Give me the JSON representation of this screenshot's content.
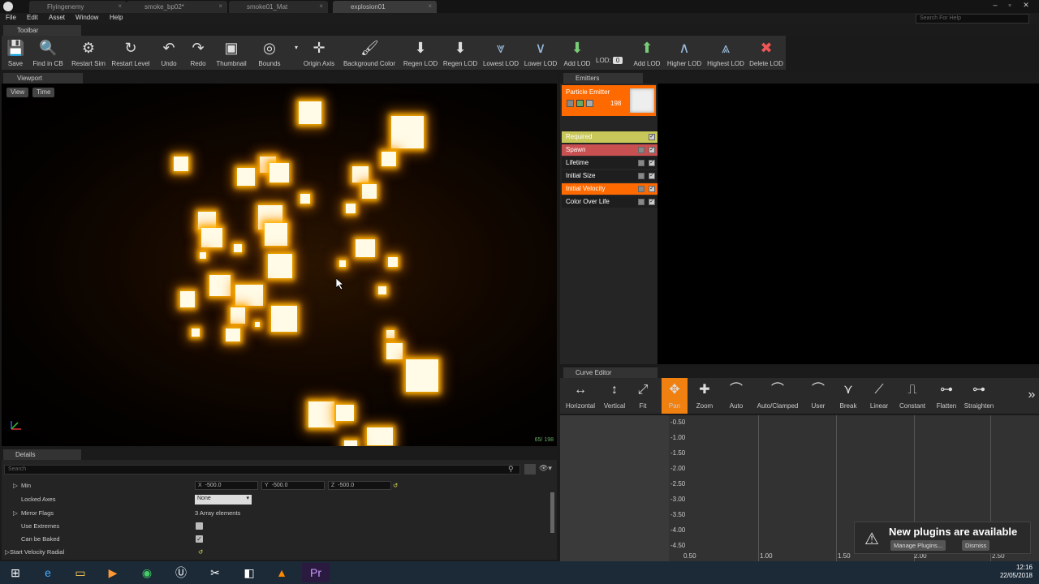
{
  "tabs": [
    {
      "label": "Flyingenemy"
    },
    {
      "label": "smoke_bp02*"
    },
    {
      "label": "smoke01_Mat"
    },
    {
      "label": "explosion01"
    }
  ],
  "menu": [
    "File",
    "Edit",
    "Asset",
    "Window",
    "Help"
  ],
  "search_help": {
    "placeholder": "Search For Help"
  },
  "toolbar": {
    "title": "Toolbar",
    "items": [
      {
        "label": "Save",
        "icon": "save-icon"
      },
      {
        "label": "Find in CB",
        "icon": "search-icon"
      },
      {
        "label": "Restart Sim",
        "icon": "gear-icon"
      },
      {
        "label": "Restart Level",
        "icon": "refresh-icon"
      },
      {
        "label": "Undo",
        "icon": "undo-icon"
      },
      {
        "label": "Redo",
        "icon": "redo-icon"
      },
      {
        "label": "Thumbnail",
        "icon": "thumbnail-icon"
      },
      {
        "label": "Bounds",
        "icon": "bounds-icon"
      },
      {
        "label": "Origin Axis",
        "icon": "axis-icon"
      },
      {
        "label": "Background Color",
        "icon": "brush-icon"
      },
      {
        "label": "Regen LOD",
        "icon": "regen-lod-icon"
      },
      {
        "label": "Regen LOD",
        "icon": "regen-lod-icon"
      },
      {
        "label": "Lowest LOD",
        "icon": "lowest-lod-icon"
      },
      {
        "label": "Lower LOD",
        "icon": "lower-lod-icon"
      },
      {
        "label": "Add LOD",
        "icon": "add-lod-icon"
      },
      {
        "label": "Add LOD",
        "icon": "add-lod-icon"
      },
      {
        "label": "Higher LOD",
        "icon": "higher-lod-icon"
      },
      {
        "label": "Highest LOD",
        "icon": "highest-lod-icon"
      },
      {
        "label": "Delete LOD",
        "icon": "delete-icon"
      }
    ],
    "lod_label": "LOD:",
    "lod_value": "0"
  },
  "viewport": {
    "title": "Viewport",
    "view_btn": "View",
    "time_btn": "Time",
    "fps_text": "65/ 198"
  },
  "details": {
    "title": "Details",
    "search_placeholder": "Search",
    "rows": {
      "min": {
        "label": "Min",
        "x": "-500.0",
        "y": "-500.0",
        "z": "-500.0"
      },
      "locked_axes": {
        "label": "Locked Axes",
        "value": "None"
      },
      "mirror_flags": {
        "label": "Mirror Flags",
        "value": "3 Array elements"
      },
      "use_extremes": {
        "label": "Use Extremes"
      },
      "can_be_baked": {
        "label": "Can be Baked"
      },
      "start_velocity_radial": {
        "label": "Start Velocity Radial"
      }
    }
  },
  "emitters": {
    "title": "Emitters",
    "emitter_name": "Particle Emitter",
    "emitter_count": "198",
    "modules": [
      {
        "label": "Required",
        "color": "#c8c85a"
      },
      {
        "label": "Spawn",
        "color": "#c85050"
      },
      {
        "label": "Lifetime",
        "color": ""
      },
      {
        "label": "Initial Size",
        "color": ""
      },
      {
        "label": "Initial Velocity",
        "color": "#ff6a00"
      },
      {
        "label": "Color Over Life",
        "color": ""
      }
    ]
  },
  "curve_editor": {
    "title": "Curve Editor",
    "tools": [
      {
        "label": "Horizontal",
        "icon": "horizontal-icon"
      },
      {
        "label": "Vertical",
        "icon": "vertical-icon"
      },
      {
        "label": "Fit",
        "icon": "fit-icon"
      },
      {
        "label": "Pan",
        "icon": "pan-icon"
      },
      {
        "label": "Zoom",
        "icon": "zoom-icon"
      },
      {
        "label": "Auto",
        "icon": "auto-icon"
      },
      {
        "label": "Auto/Clamped",
        "icon": "auto-clamped-icon"
      },
      {
        "label": "User",
        "icon": "user-icon"
      },
      {
        "label": "Break",
        "icon": "break-icon"
      },
      {
        "label": "Linear",
        "icon": "linear-icon"
      },
      {
        "label": "Constant",
        "icon": "constant-icon"
      },
      {
        "label": "Flatten",
        "icon": "flatten-icon"
      },
      {
        "label": "Straighten",
        "icon": "straighten-icon"
      }
    ],
    "y_labels": [
      "-0.50",
      "-1.00",
      "-1.50",
      "-2.00",
      "-2.50",
      "-3.00",
      "-3.50",
      "-4.00",
      "-4.50"
    ],
    "x_labels": [
      "0.50",
      "1.00",
      "1.50",
      "2.00",
      "2.50"
    ]
  },
  "notification": {
    "title": "New plugins are available",
    "manage_btn": "Manage Plugins...",
    "dismiss_btn": "Dismiss"
  },
  "taskbar": {
    "time": "12:16",
    "date": "22/05/2018"
  },
  "colors": {
    "accent": "#ff6a00",
    "glow": "#ffb200"
  }
}
